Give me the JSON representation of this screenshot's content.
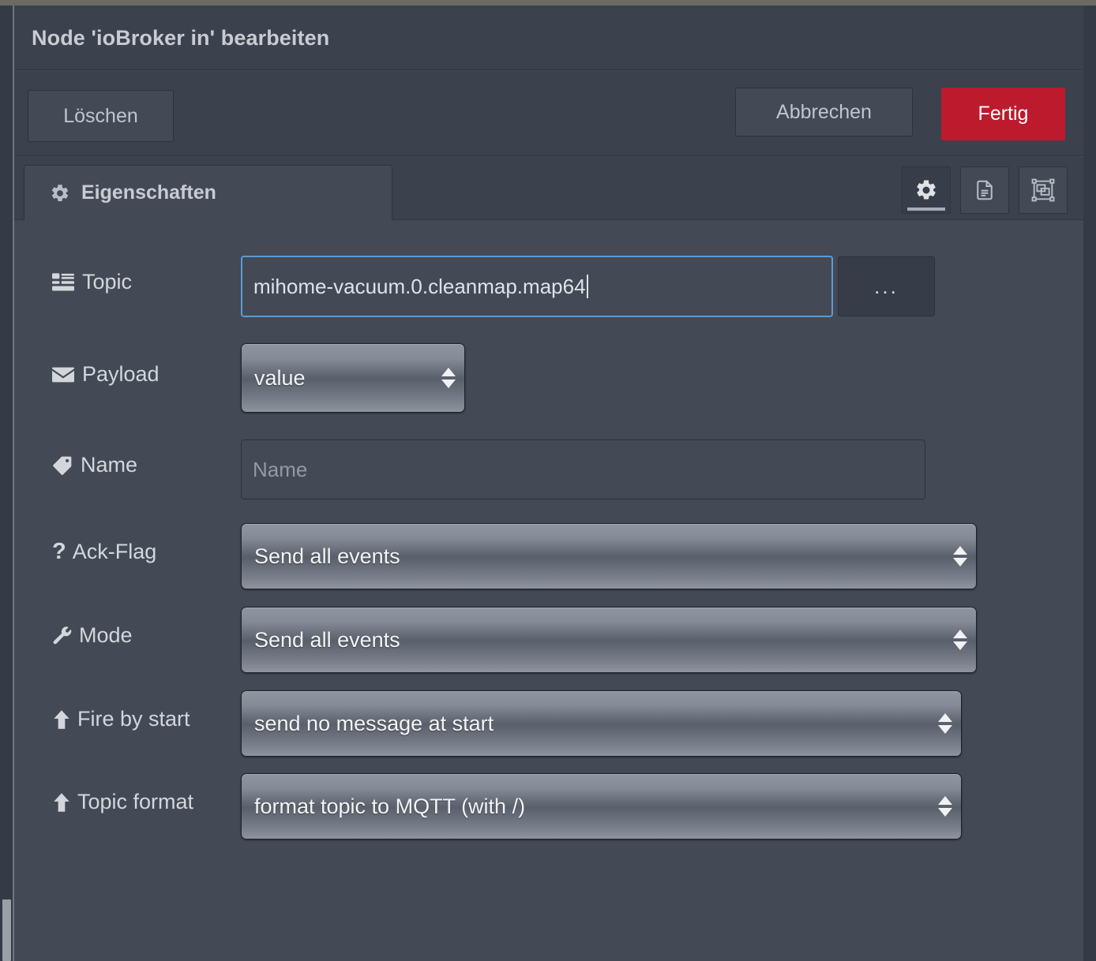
{
  "dialog": {
    "title": "Node 'ioBroker in' bearbeiten"
  },
  "buttons": {
    "delete_label": "Löschen",
    "cancel_label": "Abbrechen",
    "done_label": "Fertig",
    "done_color": "#bd1b2d"
  },
  "tabs": {
    "properties": {
      "label": "Eigenschaften",
      "icon": "gear-icon",
      "active": true
    }
  },
  "icon_buttons": [
    {
      "name": "gear-icon",
      "active": true
    },
    {
      "name": "description-icon",
      "active": false
    },
    {
      "name": "appearance-icon",
      "active": false
    }
  ],
  "form": {
    "topic": {
      "label": "Topic",
      "icon": "tasks-list-icon",
      "value": "mihome-vacuum.0.cleanmap.map64",
      "focused": true,
      "browse_label": "..."
    },
    "payload": {
      "label": "Payload",
      "icon": "envelope-icon",
      "value": "value"
    },
    "name": {
      "label": "Name",
      "icon": "tag-icon",
      "value": "",
      "placeholder": "Name"
    },
    "ack_flag": {
      "label": "Ack-Flag",
      "icon": "question-mark-icon",
      "value": "Send all events"
    },
    "mode": {
      "label": "Mode",
      "icon": "wrench-icon",
      "value": "Send all events"
    },
    "fire_by_start": {
      "label": "Fire by start",
      "icon": "arrow-up-icon",
      "value": "send no message at start"
    },
    "topic_format": {
      "label": "Topic format",
      "icon": "arrow-up-icon",
      "value": "format topic to MQTT (with /)"
    }
  }
}
